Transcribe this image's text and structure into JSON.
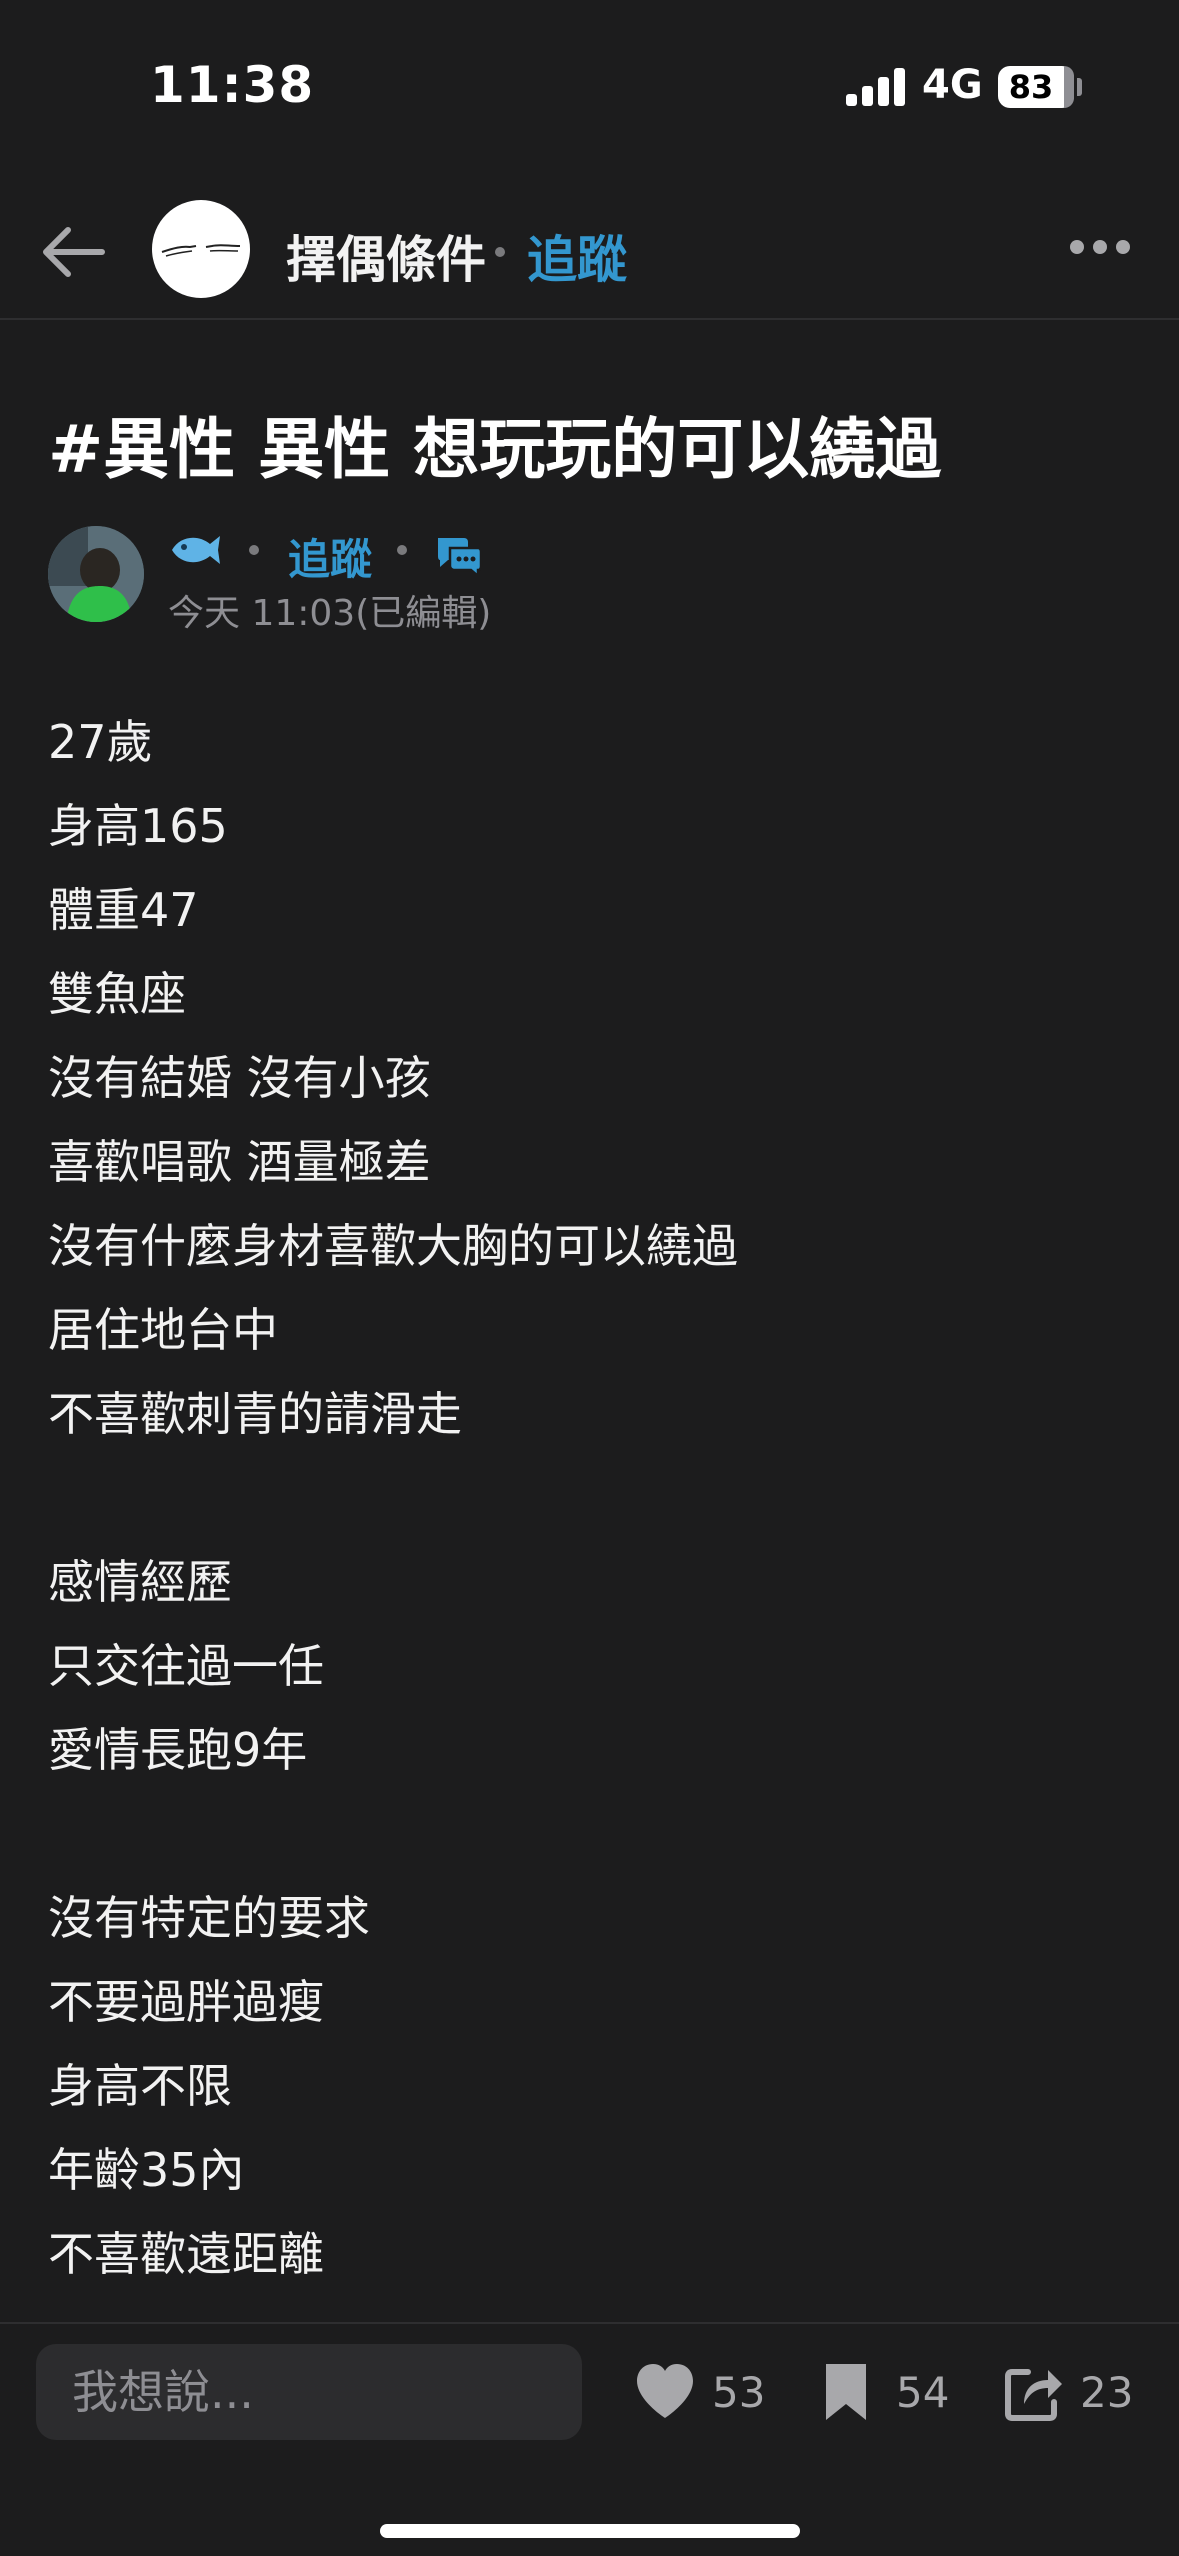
{
  "status_bar": {
    "time": "11:38",
    "network": "4G",
    "battery": "83"
  },
  "header": {
    "board_name": "擇偶條件",
    "follow_label": "追蹤"
  },
  "post": {
    "title": "#異性 異性 想玩玩的可以繞過",
    "author": {
      "emoji": "🐟",
      "follow_label": "追蹤",
      "timestamp": "今天 11:03(已編輯)"
    },
    "body_lines": [
      "27歲",
      "身高165",
      "體重47",
      "雙魚座",
      "沒有結婚 沒有小孩",
      "喜歡唱歌 酒量極差",
      "沒有什麼身材喜歡大胸的可以繞過",
      "居住地台中",
      "不喜歡刺青的請滑走",
      "",
      "感情經歷",
      "只交往過一任",
      "愛情長跑9年",
      "",
      "沒有特定的要求",
      "不要過胖過瘦",
      "身高不限",
      "年齡35內",
      "不喜歡遠距離"
    ]
  },
  "bottom_bar": {
    "comment_placeholder": "我想說...",
    "likes": "53",
    "bookmarks": "54",
    "shares": "23"
  },
  "icons": {
    "back": "arrow-left-icon",
    "more": "more-horizontal-icon",
    "chat": "chat-bubble-icon",
    "like": "heart-icon",
    "bookmark": "bookmark-icon",
    "share": "share-icon"
  },
  "colors": {
    "background": "#1c1c1d",
    "accent": "#3397cf",
    "text": "#f2f2f2",
    "muted": "#8e8e93"
  }
}
